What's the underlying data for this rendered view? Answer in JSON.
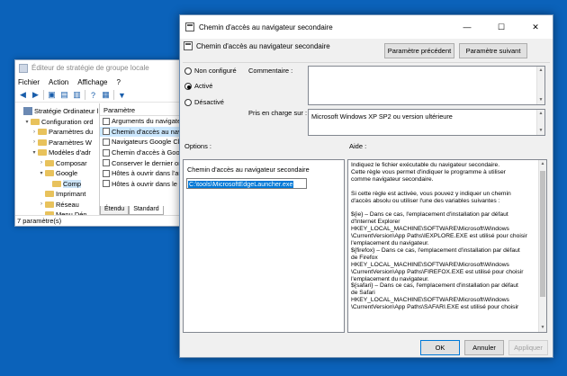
{
  "gpe": {
    "title": "Éditeur de stratégie de groupe locale",
    "menu": [
      "Fichier",
      "Action",
      "Affichage",
      "?"
    ],
    "tree": [
      {
        "label": "Stratégie Ordinateur l",
        "indent": 0,
        "exp": "",
        "icon": "gpo"
      },
      {
        "label": "Configuration ord",
        "indent": 1,
        "exp": "▾",
        "icon": "folder"
      },
      {
        "label": "Paramètres du",
        "indent": 2,
        "exp": "›",
        "icon": "folder"
      },
      {
        "label": "Paramètres W",
        "indent": 2,
        "exp": "›",
        "icon": "folder"
      },
      {
        "label": "Modèles d'adr",
        "indent": 2,
        "exp": "▾",
        "icon": "folder"
      },
      {
        "label": "Composar",
        "indent": 3,
        "exp": "›",
        "icon": "folder"
      },
      {
        "label": "Google",
        "indent": 3,
        "exp": "▾",
        "icon": "folder"
      },
      {
        "label": "Comp",
        "indent": 4,
        "exp": "",
        "icon": "folder",
        "selected": true
      },
      {
        "label": "Imprimant",
        "indent": 3,
        "exp": "",
        "icon": "folder"
      },
      {
        "label": "Réseau",
        "indent": 3,
        "exp": "›",
        "icon": "folder"
      },
      {
        "label": "Menu Dén",
        "indent": 3,
        "exp": "",
        "icon": "folder"
      }
    ],
    "list_header": "Paramètre",
    "list": [
      "Arguments du navigateur",
      "Chemin d'accès au navigateur",
      "Navigateurs Google Chrome",
      "Chemin d'accès à Google",
      "Conserver le dernier onglet",
      "Hôtes à ouvrir dans l'autre",
      "Hôtes à ouvrir dans le r"
    ],
    "tabs": [
      "Étendu",
      "Standard"
    ],
    "status": "7 paramètre(s)"
  },
  "dialog": {
    "title": "Chemin d'accès au navigateur secondaire",
    "header": "Chemin d'accès au navigateur secondaire",
    "prev_button": "Paramètre précédent",
    "next_button": "Paramètre suivant",
    "radios": [
      "Non configuré",
      "Activé",
      "Désactivé"
    ],
    "selected_radio": "Activé",
    "comment_label": "Commentaire :",
    "support_label": "Pris en charge sur :",
    "support_value": "Microsoft Windows XP SP2 ou version ultérieure",
    "options_label": "Options :",
    "help_label": "Aide :",
    "option_title": "Chemin d'accès au navigateur secondaire",
    "option_value": "C:\\tools\\MicrosoftEdgeLauncher.exe",
    "help_text": "Indiquez le fichier exécutable du navigateur secondaire.\nCette règle vous permet d'indiquer le programme à utiliser\ncomme navigateur secondaire.\n\nSi cette règle est activée, vous pouvez y indiquer un chemin\nd'accès absolu ou utiliser l'une des variables suivantes :\n\n${ie} – Dans ce cas, l'emplacement d'installation par défaut\nd'Internet Explorer\nHKEY_LOCAL_MACHINE\\SOFTWARE\\Microsoft\\Windows\n\\CurrentVersion\\App Paths\\IEXPLORE.EXE est utilisé pour choisir\nl'emplacement du navigateur.\n${firefox} – Dans ce cas, l'emplacement d'installation par défaut\nde Firefox\nHKEY_LOCAL_MACHINE\\SOFTWARE\\Microsoft\\Windows\n\\CurrentVersion\\App Paths\\FIREFOX.EXE est utilisé pour choisir\nl'emplacement du navigateur.\n${safari} – Dans ce cas, l'emplacement d'installation par défaut\nde Safari\nHKEY_LOCAL_MACHINE\\SOFTWARE\\Microsoft\\Windows\n\\CurrentVersion\\App Paths\\SAFARI.EXE est utilisé pour choisir",
    "ok_button": "OK",
    "cancel_button": "Annuler",
    "apply_button": "Appliquer"
  },
  "colors": {
    "desktop": "#0b62ba",
    "accent": "#0078d7"
  }
}
